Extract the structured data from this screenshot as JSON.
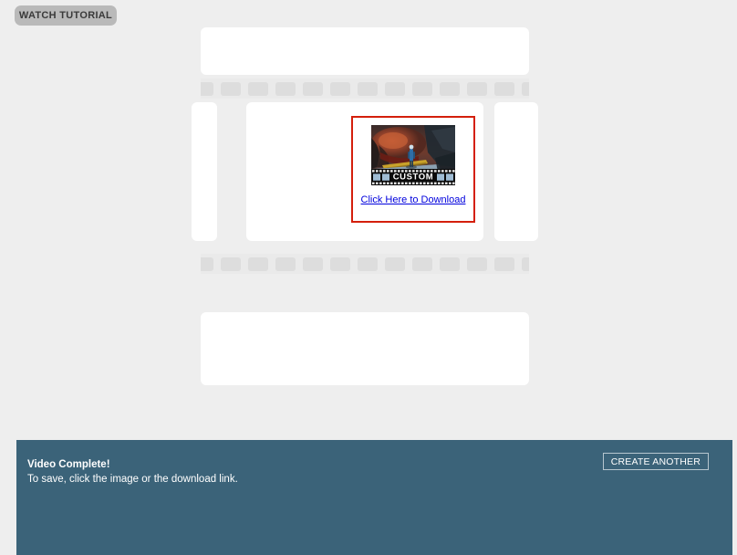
{
  "tutorial_button": {
    "label": "WATCH TUTORIAL"
  },
  "filmstrip": {
    "perforation_count": 13,
    "frame_background": "#ffffff",
    "band_background": "#eaeaea",
    "perforation_color": "#dddddd"
  },
  "download_card": {
    "border_color": "#d41f0c",
    "link_label": "Click Here to Download",
    "link_color": "#0000dd",
    "thumbnail": {
      "alt": "video-thumbnail",
      "caption": "CUSTOM"
    }
  },
  "status_bar": {
    "background": "#3b6379",
    "title": "Video Complete!",
    "subtitle": "To save, click the image or the download link.",
    "action_label": "CREATE ANOTHER"
  }
}
